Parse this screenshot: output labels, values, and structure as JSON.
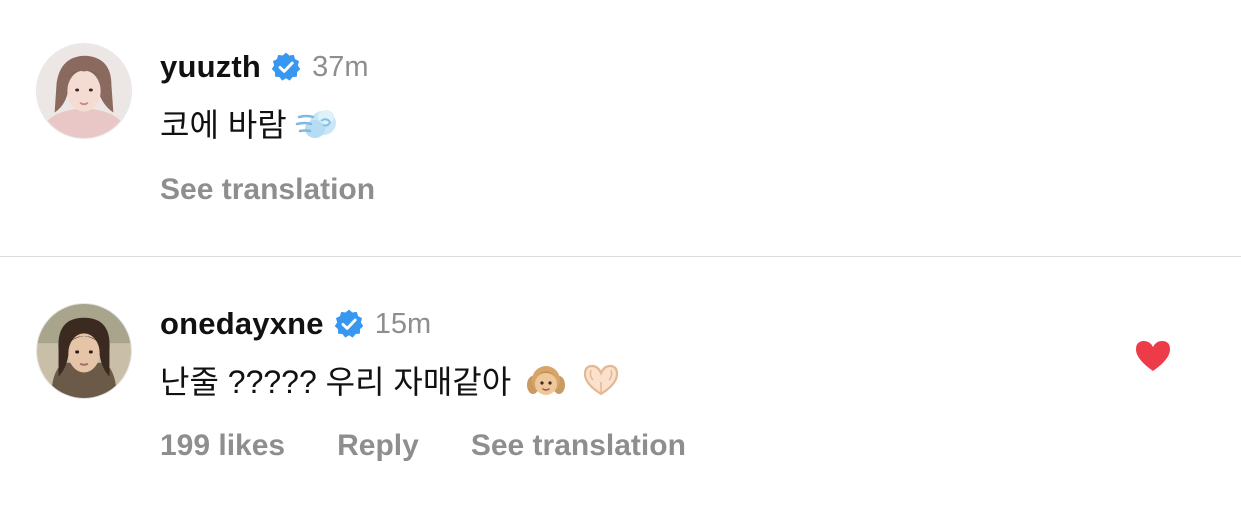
{
  "comments": [
    {
      "username": "yuuzth",
      "verified": true,
      "time": "37m",
      "text": "코에 바람",
      "emoji_icons": [
        "dashing-away-emoji"
      ],
      "see_translation": "See translation"
    },
    {
      "username": "onedayxne",
      "verified": true,
      "time": "15m",
      "text": "난줄 ????? 우리 자매같아",
      "emoji_icons": [
        "girl-emoji",
        "heart-hands-emoji"
      ],
      "likes": "199 likes",
      "reply": "Reply",
      "see_translation": "See translation",
      "liked": true
    }
  ],
  "colors": {
    "verified_badge": "#3897f0",
    "heart": "#ed3b4a",
    "secondary_text": "#8e8e8e",
    "divider": "#dbdbdb"
  },
  "icons": {
    "verified": "verified-badge-icon",
    "like": "heart-icon"
  }
}
